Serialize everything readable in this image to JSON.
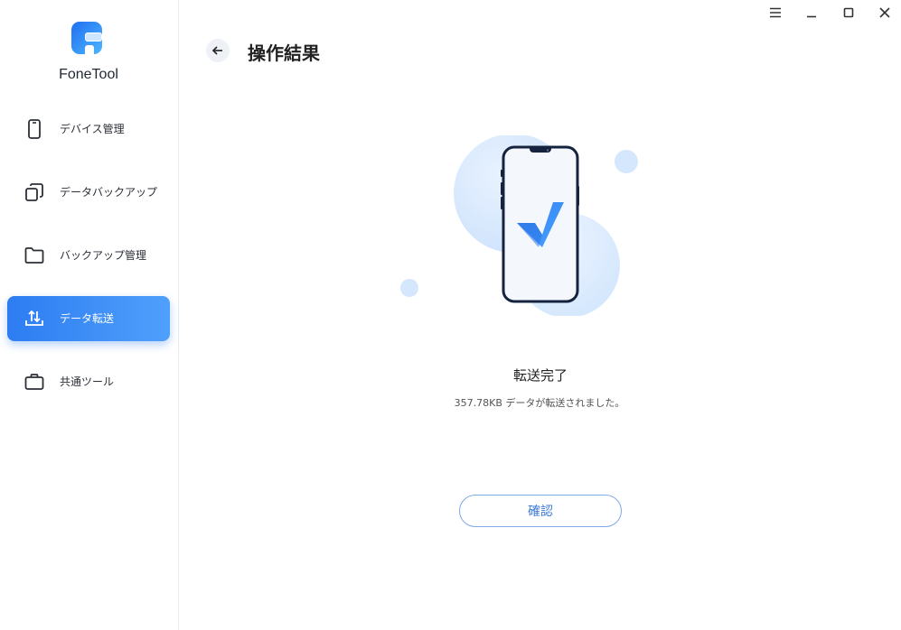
{
  "app": {
    "name": "FoneTool",
    "brand_color": "#2d7cf2"
  },
  "window_controls": [
    {
      "name": "menu-icon"
    },
    {
      "name": "minimize-icon"
    },
    {
      "name": "maximize-icon"
    },
    {
      "name": "close-icon"
    }
  ],
  "sidebar": {
    "items": [
      {
        "label": "デバイス管理",
        "icon": "phone-icon",
        "active": false
      },
      {
        "label": "データバックアップ",
        "icon": "copy-icon",
        "active": false
      },
      {
        "label": "バックアップ管理",
        "icon": "folder-icon",
        "active": false
      },
      {
        "label": "データ転送",
        "icon": "transfer-icon",
        "active": true
      },
      {
        "label": "共通ツール",
        "icon": "toolbox-icon",
        "active": false
      }
    ]
  },
  "header": {
    "title": "操作結果",
    "back_icon": "arrow-left-icon"
  },
  "result": {
    "title": "転送完了",
    "description": "357.78KB データが転送されました。",
    "confirm_label": "確認",
    "illustration_icon": "phone-checkmark-icon"
  }
}
